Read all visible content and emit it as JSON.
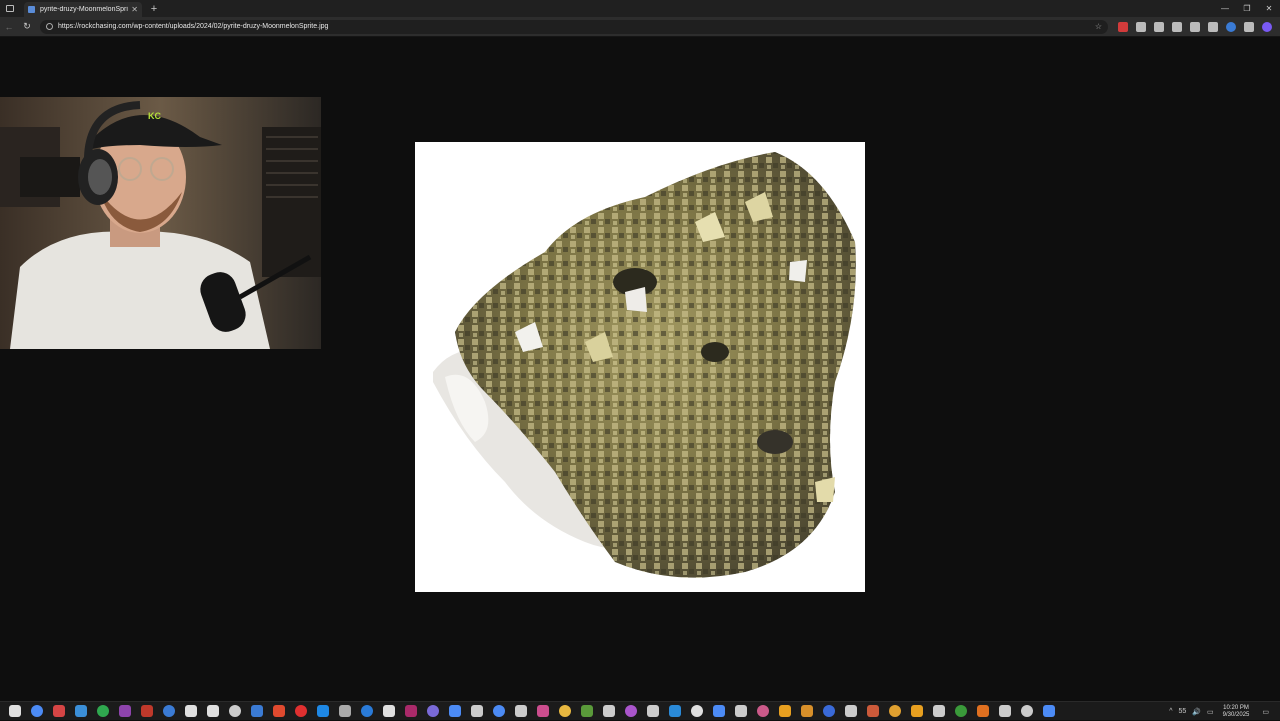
{
  "browser": {
    "tab": {
      "title": "pyrite-druzy-MoonmelonSprite.jpg",
      "close_glyph": "✕",
      "favicon": "image-file-icon"
    },
    "new_tab_glyph": "+",
    "window_controls": {
      "minimize": "—",
      "restore": "❐",
      "close": "✕"
    },
    "nav": {
      "back": "←",
      "forward": "→",
      "reload": "↻"
    },
    "url": "https://rockchasing.com/wp-content/uploads/2024/02/pyrite-druzy-MoonmelonSprite.jpg",
    "bookmark_glyph": "☆",
    "extensions": [
      "red-ext-icon",
      "puzzle-icon",
      "shield-icon",
      "refresh-icon",
      "share-icon",
      "favorites-icon",
      "profile-icon",
      "menu-icon",
      "copilot-icon"
    ],
    "extension_colors": [
      "#d23b3b",
      "#bbbbbb",
      "#bbbbbb",
      "#bbbbbb",
      "#bbbbbb",
      "#bbbbbb",
      "#3a7bd5",
      "#bbbbbb",
      "#7a5af5"
    ],
    "more_glyph": "⋯"
  },
  "viewer": {
    "image_subject": "pyrite druzy mineral specimen",
    "background": "#0e0e0e"
  },
  "taskbar": {
    "icon_colors": [
      "#e0e0e0",
      "#4c8bf5",
      "#d64545",
      "#3b8fd8",
      "#2fa84f",
      "#8e44ad",
      "#c0392b",
      "#3b7bd4",
      "#e0e0e0",
      "#e0e0e0",
      "#cccccc",
      "#3b7bd4",
      "#e04a2f",
      "#e03030",
      "#1e88e5",
      "#aaaaaa",
      "#2a7bd8",
      "#e0e0e0",
      "#aa2a6a",
      "#7a6ad8",
      "#4c8bf5",
      "#cccccc",
      "#4c8bf5",
      "#cccccc",
      "#cc4d8e",
      "#e8b840",
      "#5a9a3a",
      "#cccccc",
      "#aa55cc",
      "#cccccc",
      "#2a8ad8",
      "#e0e0e0",
      "#4c8bf5",
      "#cccccc",
      "#cc5a8a",
      "#e8a020",
      "#d8902a",
      "#3a6ad8",
      "#cccccc",
      "#cc5a3a",
      "#e0a030",
      "#e8a020",
      "#cccccc",
      "#3a9a3a",
      "#e07020",
      "#cccccc",
      "#cccccc",
      "#4c8bf5"
    ],
    "time": "10:20 PM",
    "date": "9/30/2025",
    "tray_items": [
      "^",
      "55",
      "🔊",
      "▭"
    ]
  }
}
